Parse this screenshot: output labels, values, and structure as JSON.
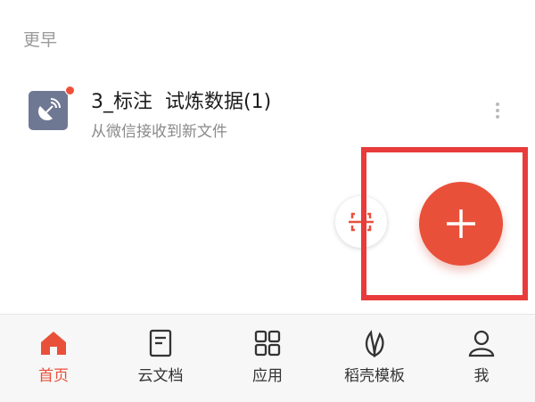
{
  "section": {
    "header": "更早"
  },
  "file": {
    "title": "3_标注  试炼数据(1)",
    "subtitle": "从微信接收到新文件",
    "icon": "wechat-satellite-icon",
    "unread": true
  },
  "actions": {
    "scan_icon": "scan-icon",
    "fab_icon": "plus-icon"
  },
  "tabbar": {
    "items": [
      {
        "label": "首页",
        "icon": "home-icon",
        "active": true
      },
      {
        "label": "云文档",
        "icon": "cloud-doc-icon",
        "active": false
      },
      {
        "label": "应用",
        "icon": "apps-grid-icon",
        "active": false
      },
      {
        "label": "稻壳模板",
        "icon": "leaf-icon",
        "active": false
      },
      {
        "label": "我",
        "icon": "person-icon",
        "active": false
      }
    ]
  },
  "colors": {
    "accent": "#e9503a",
    "highlight": "#e83b3b",
    "file_icon_bg": "#6f7893"
  }
}
